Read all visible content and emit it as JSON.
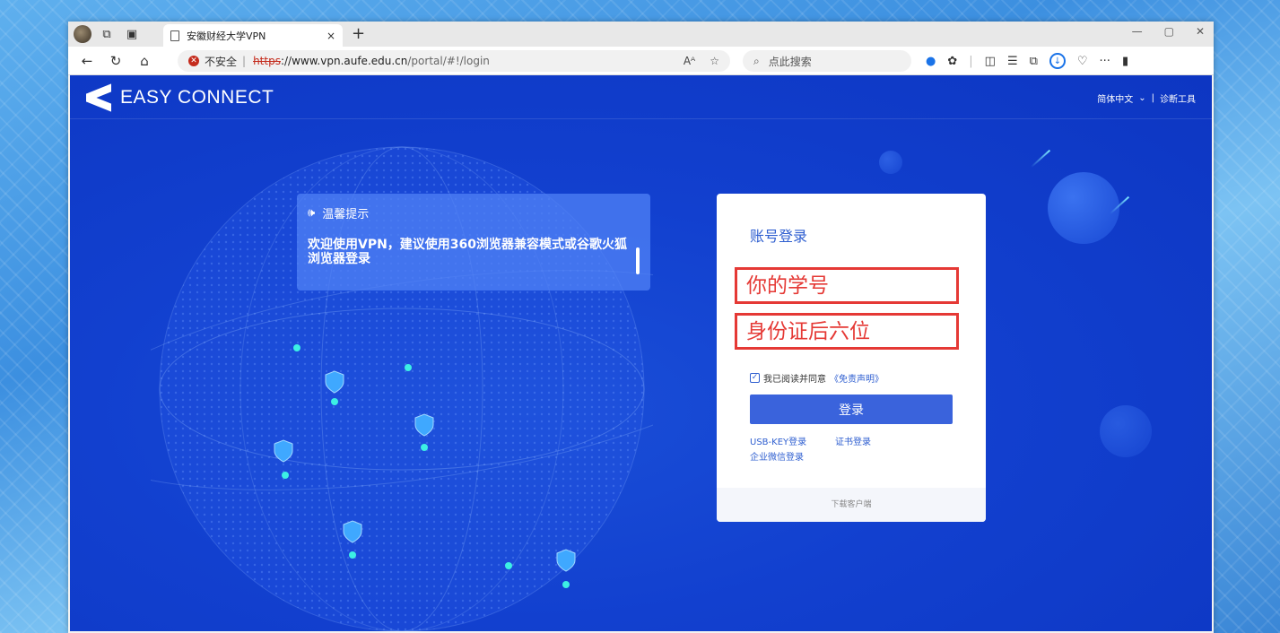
{
  "browser": {
    "tab_title": "安徽财经大学VPN",
    "tab_close": "×",
    "new_tab": "+",
    "window_controls": [
      "—",
      "▢",
      "✕"
    ],
    "security_label": "不安全",
    "url_https": "https",
    "url_host": "://www.vpn.aufe.edu.cn",
    "url_path": "/portal/#!/login",
    "search_placeholder": "点此搜索"
  },
  "page": {
    "logo_text": "EASY CONNECT",
    "language": "简体中文",
    "separator": "|",
    "diagnose": "诊断工具",
    "notice": {
      "heading": "温馨提示",
      "body": "欢迎使用VPN，建议使用360浏览器兼容模式或谷歌火狐浏览器登录"
    },
    "login": {
      "title": "账号登录",
      "username_hint": "你的学号",
      "password_hint": "身份证后六位",
      "agree_text": "我已阅读并同意",
      "agree_link": "《免责声明》",
      "button": "登录",
      "usb_key": "USB-KEY登录",
      "cert": "证书登录",
      "wechat": "企业微信登录",
      "download": "下载客户端"
    }
  },
  "colors": {
    "page_bg": "#1240cf",
    "accent": "#3a63dc",
    "highlight": "#e53935"
  }
}
